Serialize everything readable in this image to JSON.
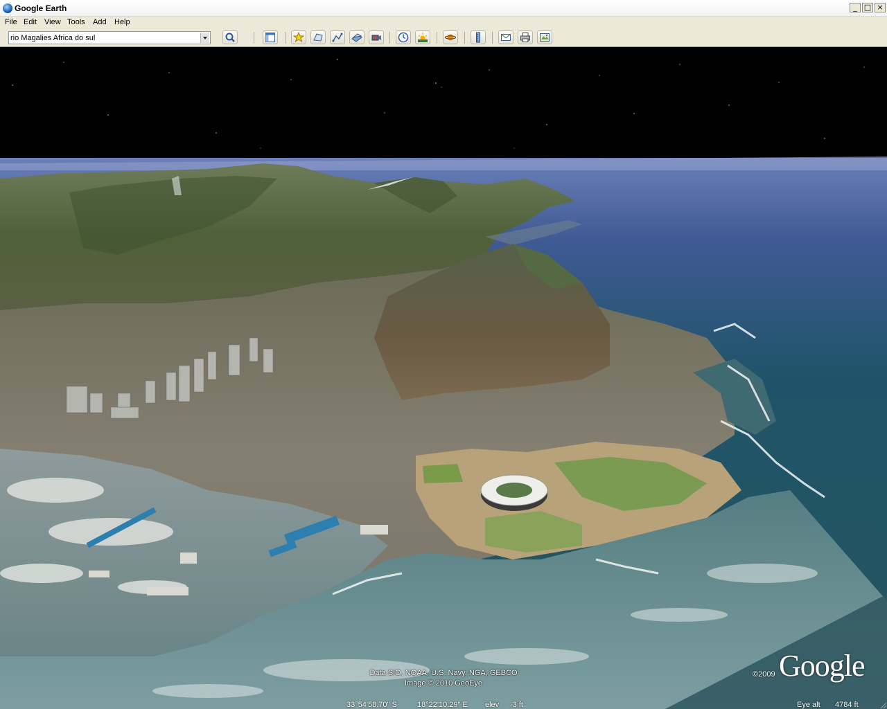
{
  "window": {
    "title": "Google Earth",
    "minimize_glyph": "_",
    "maximize_glyph": "□",
    "close_glyph": "×"
  },
  "menu": {
    "items": [
      {
        "label": "File"
      },
      {
        "label": "Edit"
      },
      {
        "label": "View"
      },
      {
        "label": "Tools"
      },
      {
        "label": "Add"
      },
      {
        "label": "Help"
      }
    ]
  },
  "search": {
    "value": "rio Magalies Africa do sul",
    "button_icon": "magnifier-icon"
  },
  "toolbar": {
    "buttons": [
      {
        "icon": "sidebar-toggle-icon"
      },
      {
        "icon": "add-placemark-icon"
      },
      {
        "icon": "add-polygon-icon"
      },
      {
        "icon": "add-path-icon"
      },
      {
        "icon": "image-overlay-icon"
      },
      {
        "icon": "record-tour-icon"
      },
      {
        "icon": "historical-imagery-icon"
      },
      {
        "icon": "sunlight-icon"
      },
      {
        "icon": "switch-planet-icon"
      },
      {
        "icon": "ruler-icon"
      },
      {
        "icon": "email-icon"
      },
      {
        "icon": "print-icon"
      },
      {
        "icon": "view-in-maps-icon"
      }
    ]
  },
  "map": {
    "attribution_line1": "Data SIO, NOAA, U.S. Navy, NGA, GEBCO",
    "attribution_line2": "Image © 2010 GeoEye",
    "copyright_year": "©2009",
    "logo_text": "Google",
    "latitude": "33°54'58.70\" S",
    "longitude": "18°22'10.29\" E",
    "elevation_label": "elev",
    "elevation_value": "-3 ft",
    "eye_alt_label": "Eye alt",
    "eye_alt_value": "4784 ft"
  },
  "colors": {
    "sky": "#000000",
    "ocean_deep": "#1c4f66",
    "ocean_shallow": "#5e8a8e",
    "mountain": "#55663f",
    "city": "#7c766b",
    "stadium": "#e8e8e8"
  }
}
